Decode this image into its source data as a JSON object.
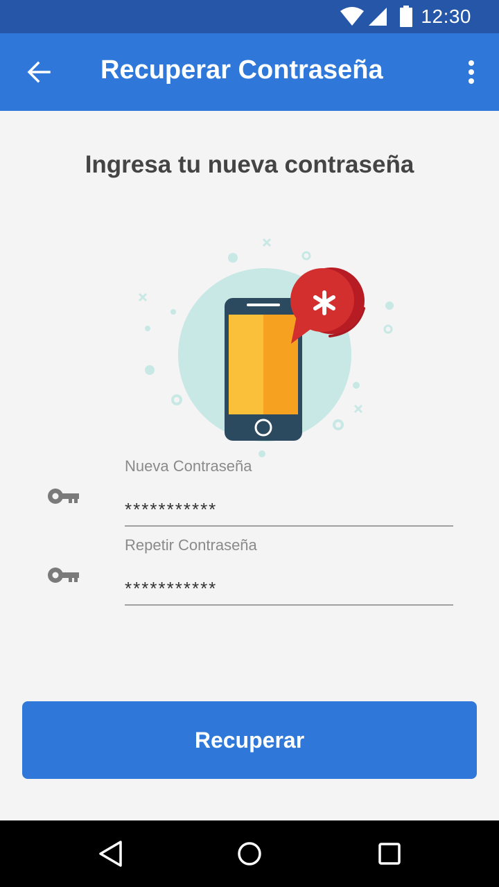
{
  "status_bar": {
    "time": "12:30",
    "color": "#2556a7"
  },
  "app_bar": {
    "title": "Recuperar Contraseña",
    "color": "#2f78d9",
    "back_icon": "arrow-back-icon",
    "menu_icon": "more-vert-icon"
  },
  "heading": "Ingresa tu nueva contraseña",
  "illustration": {
    "name": "phone-password-illustration",
    "accent": "#d32f2f",
    "circle": "#c7e8e4"
  },
  "fields": [
    {
      "label": "Nueva Contraseña",
      "value": "***********",
      "icon": "key-icon"
    },
    {
      "label": "Repetir Contraseña",
      "value": "***********",
      "icon": "key-icon"
    }
  ],
  "button": {
    "label": "Recuperar",
    "color": "#2f78d9"
  },
  "nav_bar": {
    "icons": [
      "back-triangle-icon",
      "home-circle-icon",
      "recents-square-icon"
    ]
  }
}
